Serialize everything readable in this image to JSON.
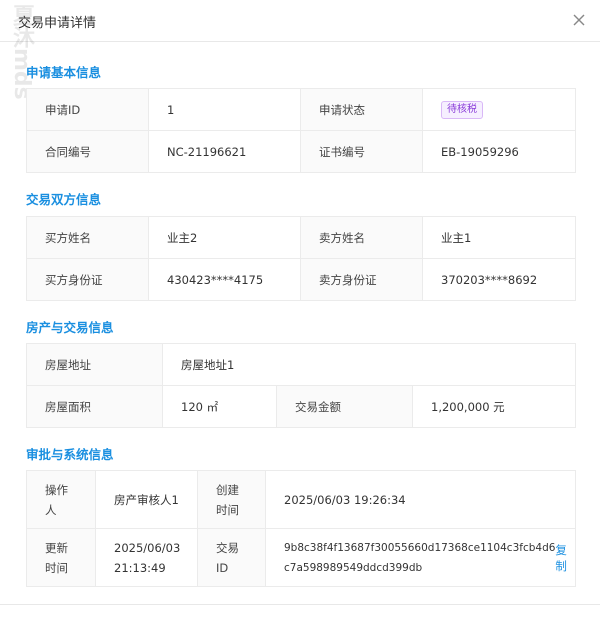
{
  "modal": {
    "title": "交易申请详情",
    "watermark": "夏沐mds"
  },
  "sections": {
    "basic": {
      "title": "申请基本信息",
      "apply_id_label": "申请ID",
      "apply_id_value": "1",
      "status_label": "申请状态",
      "status_value": "待核税",
      "contract_label": "合同编号",
      "contract_value": "NC-21196621",
      "cert_label": "证书编号",
      "cert_value": "EB-19059296"
    },
    "parties": {
      "title": "交易双方信息",
      "buyer_name_label": "买方姓名",
      "buyer_name_value": "业主2",
      "seller_name_label": "卖方姓名",
      "seller_name_value": "业主1",
      "buyer_id_label": "买方身份证",
      "buyer_id_value": "430423****4175",
      "seller_id_label": "卖方身份证",
      "seller_id_value": "370203****8692"
    },
    "property": {
      "title": "房产与交易信息",
      "address_label": "房屋地址",
      "address_value": "房屋地址1",
      "area_label": "房屋面积",
      "area_value": "120 ㎡",
      "amount_label": "交易金额",
      "amount_value": "1,200,000 元"
    },
    "approval": {
      "title": "审批与系统信息",
      "operator_label_1": "操作",
      "operator_label_2": "人",
      "operator_value": "房产审核人1",
      "created_label_1": "创建",
      "created_label_2": "时间",
      "created_value": "2025/06/03 19:26:34",
      "updated_label_1": "更新",
      "updated_label_2": "时间",
      "updated_value_1": "2025/06/03",
      "updated_value_2": "21:13:49",
      "tx_label_1": "交易",
      "tx_label_2": "ID",
      "tx_value_1": "9b8c38f4f13687f30055660d17368ce1104c3fcb4d6",
      "tx_value_2": "c7a598989549ddcd399db",
      "copy_label": "复制"
    }
  },
  "colors": {
    "accent": "#1a8fe0",
    "badge_text": "#8a3bd9",
    "badge_bg": "#f6efff",
    "label_bg": "#fafafa",
    "border": "#ebebeb"
  }
}
